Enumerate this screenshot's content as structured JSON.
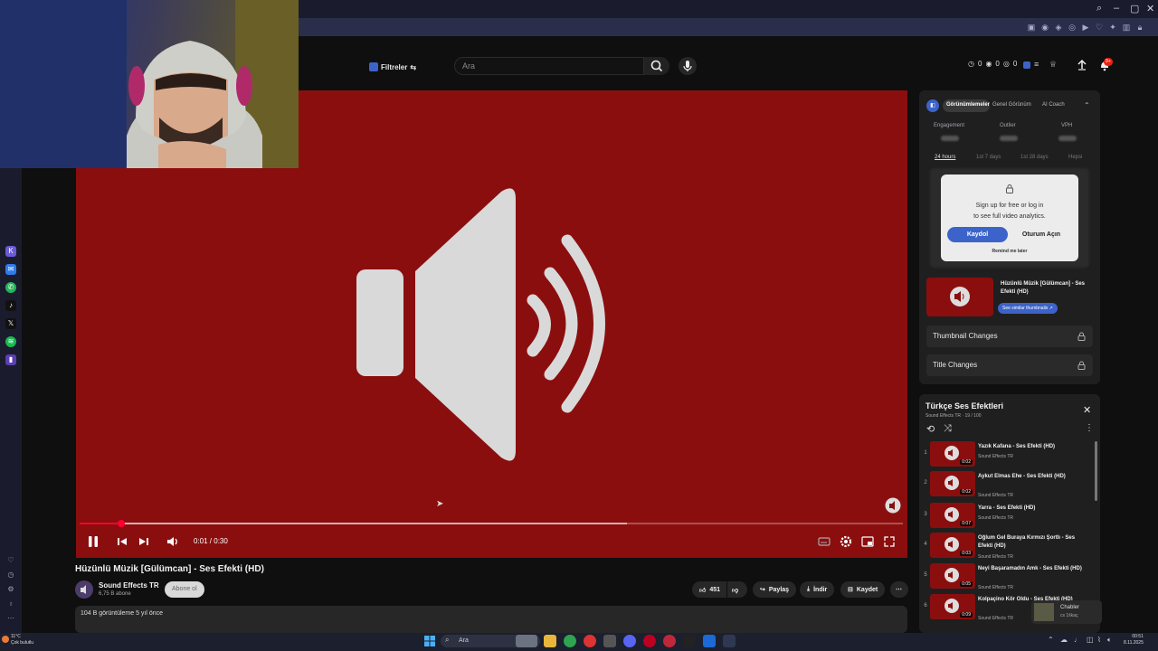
{
  "browser": {
    "window_controls": [
      "⌕",
      "–",
      "▢",
      "✕"
    ]
  },
  "youtube": {
    "filters_label": "Filtreler",
    "search_placeholder": "Ara",
    "counters": [
      "0",
      "0",
      "0"
    ],
    "notifications_badge": "9+"
  },
  "player": {
    "time": "0:01 / 0:30",
    "progress_played": 0.05,
    "progress_buffered": 0.665
  },
  "video": {
    "title": "Hüzünlü Müzik [Gülümcan] - Ses Efekti (HD)",
    "channel": "Sound Effects TR",
    "subscribers": "6,75 B abone",
    "subscribe_label": "Abone ol",
    "likes": "451",
    "share_label": "Paylaş",
    "download_label": "İndir",
    "save_label": "Kaydet",
    "views": "104 B görüntüleme  5 yıl önce"
  },
  "analytics": {
    "tabs": [
      "Görünümlemeler",
      "Genel Görünüm",
      "AI Coach"
    ],
    "metrics": [
      "Engagement",
      "Outlier",
      "VPH"
    ],
    "ranges": [
      "24 hours",
      "1st 7 days",
      "1st 28 days",
      "Hepsi"
    ],
    "signup_line1": "Sign up for free or log in",
    "signup_line2": "to see full video analytics.",
    "register_label": "Kaydol",
    "login_label": "Oturum Açın",
    "remind_label": "Remind me later",
    "video_title": "Hüzünlü Müzik [Gülümcan] - Ses Efekti (HD)",
    "similar_label": "See similar thumbnails ↗",
    "thumbnail_changes": "Thumbnail Changes",
    "title_changes": "Title Changes"
  },
  "playlist": {
    "title": "Türkçe Ses Efektleri",
    "subtitle": "Sound Effects TR · 19 / 100",
    "items": [
      {
        "index": "1",
        "title": "Yazık Kafana - Ses Efekti (HD)",
        "channel": "Sound Effects TR",
        "duration": "0:02"
      },
      {
        "index": "2",
        "title": "Aykut Elmas Ehe - Ses Efekti (HD)",
        "channel": "Sound Effects TR",
        "duration": "0:02"
      },
      {
        "index": "3",
        "title": "Yarra - Ses Efekti (HD)",
        "channel": "Sound Effects TR",
        "duration": "0:07"
      },
      {
        "index": "4",
        "title": "Oğlum Gel Buraya Kırmızı Şortlı - Ses Efekti (HD)",
        "channel": "Sound Effects TR",
        "duration": "0:03"
      },
      {
        "index": "5",
        "title": "Neyi Başaramadın Amk - Ses Efekti (HD)",
        "channel": "Sound Effects TR",
        "duration": "0:05"
      },
      {
        "index": "6",
        "title": "Kolpaçino Kör Oldu - Ses Efekti (HD)",
        "channel": "Sound Effects TR",
        "duration": "0:09"
      }
    ]
  },
  "taskbar": {
    "weather_temp": "11°C",
    "weather_desc": "Çok bulutlu",
    "search_label": "Ara",
    "time": "00:51",
    "date": "8.11.2025",
    "notif_title": "Chabler",
    "notif_sub": "cs 1škaç"
  },
  "colors": {
    "player_bg": "#8b0e0e",
    "progress": "#ff0033",
    "accent_blue": "#3b63c9"
  }
}
